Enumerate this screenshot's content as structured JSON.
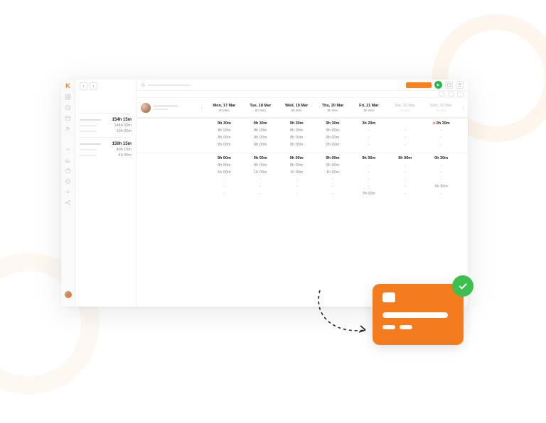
{
  "brand": {
    "logo_letter": "K",
    "accent": "#f6811e",
    "success": "#3cbf4e"
  },
  "days": [
    {
      "label": "Mon, 17 Mar",
      "total": "8h 06m",
      "weekend": false
    },
    {
      "label": "Tue, 18 Mar",
      "total": "8h 06m",
      "weekend": false
    },
    {
      "label": "Wed, 19 Mar",
      "total": "8h 06m",
      "weekend": false
    },
    {
      "label": "Thu, 20 Mar",
      "total": "8h 06m",
      "weekend": false
    },
    {
      "label": "Fri, 21 Mar",
      "total": "8h 06m",
      "weekend": false
    },
    {
      "label": "Sat, 22 Mar",
      "total": "0h 00m",
      "weekend": true
    },
    {
      "label": "Sun, 23 Mar",
      "total": "0h 00m",
      "weekend": true
    }
  ],
  "summary": {
    "group1": {
      "total": "154h 15m",
      "rows": [
        "144h 00m",
        "10h 00m"
      ]
    },
    "group2": {
      "total": "150h 15m",
      "rows": [
        "40h 15m",
        "4h 00m"
      ]
    }
  },
  "grid": {
    "section1": {
      "header": [
        "9h 30m",
        "9h 30m",
        "9h 30m",
        "9h 30m",
        "3h 29m",
        "",
        "0h 30m"
      ],
      "header_warn_index": 6,
      "rows": [
        [
          "8h 00m",
          "8h 00m",
          "8h 00m",
          "8h 00m",
          "-",
          "-",
          "-"
        ],
        [
          "8h 00m",
          "8h 00m",
          "8h 00m",
          "8h 00m",
          "-",
          "-",
          "-"
        ],
        [
          "8h 00m",
          "8h 00m",
          "8h 00m",
          "8h 00m",
          "-",
          "-",
          "-"
        ]
      ]
    },
    "section2": {
      "header": [
        "9h 00m",
        "9h 00m",
        "9h 00m",
        "9h 00m",
        "9h 00m",
        "9h 00m",
        "0h 30m"
      ],
      "rows": [
        [
          "8h 00m",
          "8h 00m",
          "8h 00m",
          "8h 00m",
          "-",
          "-",
          "-"
        ],
        [
          "1h 00m",
          "1h 00m",
          "1h 00m",
          "1h 00m",
          "-",
          "-",
          "-"
        ],
        [
          "-",
          "-",
          "-",
          "-",
          "-",
          "-",
          "-"
        ],
        [
          "-",
          "-",
          "-",
          "-",
          "-",
          "-",
          "9h 30m"
        ],
        [
          "-",
          "-",
          "-",
          "-",
          "3h 00m",
          "-",
          "-"
        ]
      ]
    }
  },
  "nav": {
    "prev": "‹",
    "next": "›"
  },
  "topbar": {
    "play": "▶"
  }
}
